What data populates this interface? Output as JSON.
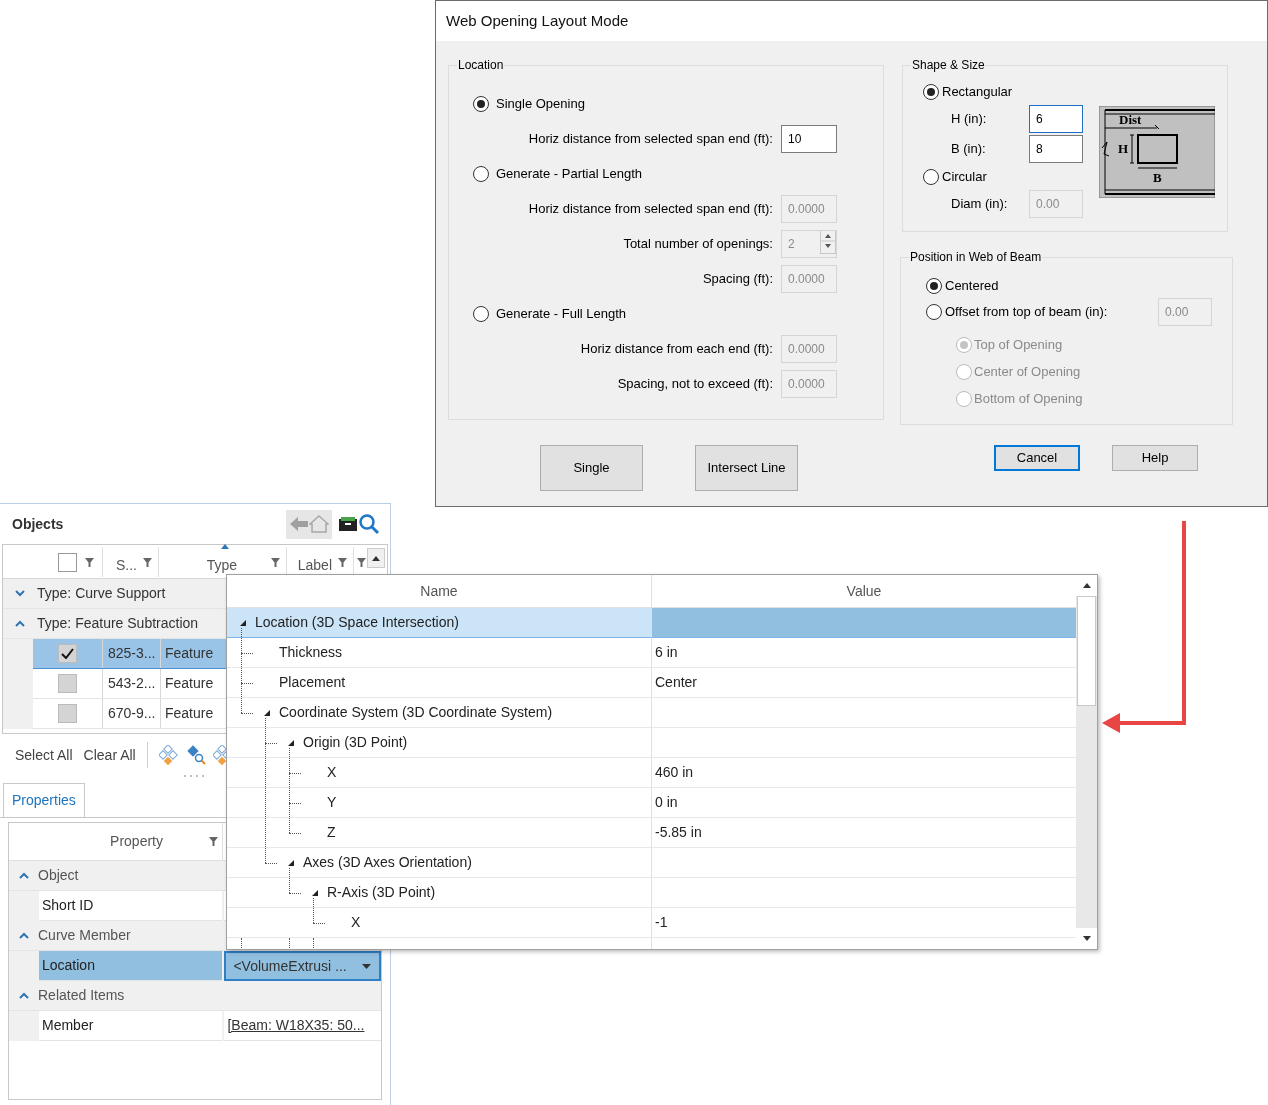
{
  "dialog": {
    "title": "Web Opening Layout Mode",
    "location": {
      "title": "Location",
      "items": [
        {
          "kind": "radio",
          "label": "Single Opening",
          "selected": true
        },
        {
          "kind": "field",
          "label": "Horiz distance from selected span end (ft):",
          "value": "10",
          "disabled": false
        },
        {
          "kind": "radio",
          "label": "Generate - Partial Length",
          "selected": false
        },
        {
          "kind": "field",
          "label": "Horiz distance from selected span end (ft):",
          "value": "0.0000",
          "disabled": true
        },
        {
          "kind": "spinner",
          "label": "Total number of openings:",
          "value": "2",
          "disabled": true
        },
        {
          "kind": "field",
          "label": "Spacing (ft):",
          "value": "0.0000",
          "disabled": true
        },
        {
          "kind": "radio",
          "label": "Generate - Full Length",
          "selected": false
        },
        {
          "kind": "field",
          "label": "Horiz distance from each end (ft):",
          "value": "0.0000",
          "disabled": true
        },
        {
          "kind": "field",
          "label": "Spacing, not to exceed (ft):",
          "value": "0.0000",
          "disabled": true
        }
      ]
    },
    "shape_size": {
      "title": "Shape & Size",
      "items": [
        {
          "kind": "radio",
          "label": "Rectangular",
          "selected": true
        },
        {
          "kind": "field",
          "label": "H (in):",
          "value": "6",
          "disabled": false,
          "focused": true
        },
        {
          "kind": "field",
          "label": "B (in):",
          "value": "8",
          "disabled": false,
          "focused": false
        },
        {
          "kind": "radio",
          "label": "Circular",
          "selected": false
        },
        {
          "kind": "field",
          "label": "Diam (in):",
          "value": "0.00",
          "disabled": true,
          "focused": false
        }
      ],
      "diagram": {
        "dist_label": "Dist",
        "h_label": "H",
        "b_label": "B"
      }
    },
    "position": {
      "title": "Position in Web of Beam",
      "options": [
        {
          "label": "Centered",
          "selected": true
        },
        {
          "label": "Offset from top of beam (in):",
          "selected": false,
          "value": "0.00",
          "disabled": true
        }
      ],
      "sub_options": [
        {
          "label": "Top of Opening",
          "selected": true,
          "disabled": true
        },
        {
          "label": "Center of Opening",
          "selected": false,
          "disabled": true
        },
        {
          "label": "Bottom of Opening",
          "selected": false,
          "disabled": true
        }
      ]
    },
    "layout_buttons": [
      {
        "label": "Single"
      },
      {
        "label": "Intersect Line"
      }
    ],
    "dialog_buttons": [
      {
        "label": "Cancel",
        "default": true
      },
      {
        "label": "Help",
        "default": false
      }
    ]
  },
  "objects": {
    "title": "Objects",
    "header_checked": false,
    "columns": [
      {
        "label": "S..."
      },
      {
        "label": "Type",
        "sorted": true
      },
      {
        "label": "Label"
      }
    ],
    "groups": [
      {
        "label": "Type: Curve Support",
        "expanded": false
      },
      {
        "label": "Type: Feature Subtraction",
        "expanded": true,
        "rows": [
          {
            "checked": true,
            "selected": true,
            "id": "825-3...",
            "type": "Feature"
          },
          {
            "checked": false,
            "selected": false,
            "id": "543-2...",
            "type": "Feature"
          },
          {
            "checked": false,
            "selected": false,
            "id": "670-9...",
            "type": "Feature"
          }
        ]
      }
    ],
    "toolbar": [
      "Select All",
      "Clear All"
    ]
  },
  "properties": {
    "tab": "Properties",
    "column": "Property",
    "groups": [
      {
        "label": "Object",
        "expanded": true,
        "rows": [
          {
            "kind": "text",
            "name": "Short ID",
            "selected": false
          }
        ]
      },
      {
        "label": "Curve Member",
        "expanded": true,
        "rows": [
          {
            "kind": "dropdown",
            "name": "Location",
            "value": "<VolumeExtrusi ...",
            "selected": true
          }
        ]
      },
      {
        "label": "Related Items",
        "expanded": true,
        "rows": [
          {
            "kind": "link",
            "name": "Member",
            "value": "[Beam: W18X35: 50...",
            "selected": false
          }
        ]
      }
    ]
  },
  "property_tree": {
    "columns": [
      "Name",
      "Value"
    ],
    "rows": [
      {
        "name": "Location (3D Space Intersection)",
        "selected": true,
        "expanded": true,
        "children": [
          {
            "name": "Thickness",
            "value": "6 in",
            "selected": false
          },
          {
            "name": "Placement",
            "value": "Center",
            "selected": false
          },
          {
            "name": "Coordinate System (3D Coordinate System)",
            "selected": false,
            "expanded": true,
            "children": [
              {
                "name": "Origin (3D Point)",
                "selected": false,
                "expanded": true,
                "children": [
                  {
                    "name": "X",
                    "value": "460 in",
                    "selected": false
                  },
                  {
                    "name": "Y",
                    "value": "0 in",
                    "selected": false
                  },
                  {
                    "name": "Z",
                    "value": "-5.85 in",
                    "selected": false
                  }
                ]
              },
              {
                "name": "Axes (3D Axes Orientation)",
                "selected": false,
                "expanded": true,
                "children": [
                  {
                    "name": "R-Axis (3D Point)",
                    "selected": false,
                    "expanded": true,
                    "children": [
                      {
                        "name": "X",
                        "value": "-1",
                        "selected": false
                      }
                    ]
                  }
                ]
              }
            ]
          }
        ]
      }
    ]
  }
}
